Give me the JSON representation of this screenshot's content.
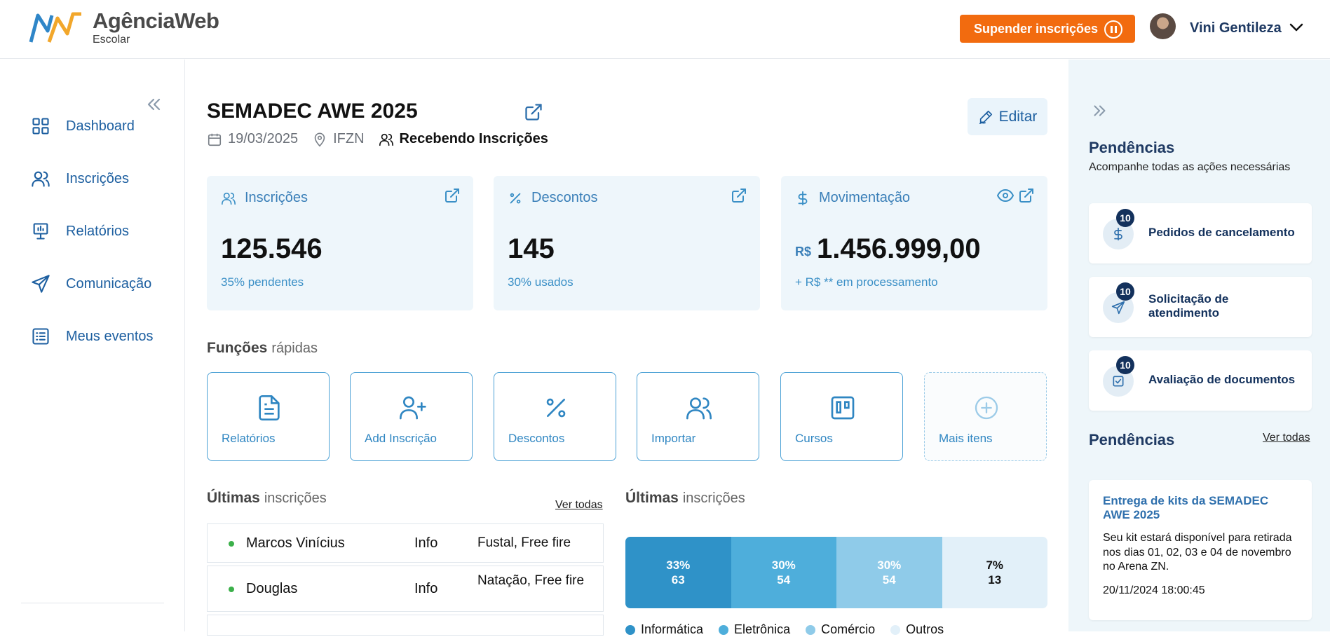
{
  "brand": {
    "name": "AgênciaWeb",
    "sub": "Escolar"
  },
  "header": {
    "suspend_label": "Supender inscrições",
    "user_name": "Vini Gentileza"
  },
  "sidebar": {
    "items": [
      {
        "label": "Dashboard",
        "icon": "grid-icon"
      },
      {
        "label": "Inscrições",
        "icon": "users-icon"
      },
      {
        "label": "Relatórios",
        "icon": "presentation-icon"
      },
      {
        "label": "Comunicação",
        "icon": "send-icon"
      },
      {
        "label": "Meus eventos",
        "icon": "list-icon"
      }
    ]
  },
  "event": {
    "title": "SEMADEC AWE 2025",
    "date": "19/03/2025",
    "location": "IFZN",
    "status": "Recebendo Inscrições",
    "edit_label": "Editar"
  },
  "cards": [
    {
      "title": "Inscrições",
      "value": "125.546",
      "sub": "35% pendentes"
    },
    {
      "title": "Descontos",
      "value": "145",
      "sub": "30% usados"
    },
    {
      "title": "Movimentação",
      "currency": "R$",
      "value": "1.456.999,00",
      "sub": "+ R$ ** em processamento"
    }
  ],
  "quick": {
    "title_bold": "Funções",
    "title_light": "rápidas",
    "items": [
      {
        "label": "Relatórios",
        "icon": "file-text-icon"
      },
      {
        "label": "Add Inscrição",
        "icon": "user-plus-icon"
      },
      {
        "label": "Descontos",
        "icon": "percent-icon"
      },
      {
        "label": "Importar",
        "icon": "users-icon"
      },
      {
        "label": "Cursos",
        "icon": "kanban-icon"
      },
      {
        "label": "Mais itens",
        "icon": "plus-circle-icon"
      }
    ]
  },
  "latest": {
    "title_bold": "Últimas",
    "title_light": "inscrições",
    "see_all": "Ver todas",
    "rows": [
      {
        "name": "Marcos Vinícius",
        "category": "Info",
        "modalities": "Fustal, Free fire"
      },
      {
        "name": "Douglas",
        "category": "Info",
        "modalities": "Natação, Free fire"
      }
    ]
  },
  "distribution": {
    "title_bold": "Últimas",
    "title_light": "inscrições",
    "segments": [
      {
        "percent": "33%",
        "count": "63",
        "share": 0.25,
        "color": "#2f92c8",
        "text_color": "#ffffff"
      },
      {
        "percent": "30%",
        "count": "54",
        "share": 0.25,
        "color": "#4eaedb",
        "text_color": "#ffffff"
      },
      {
        "percent": "30%",
        "count": "54",
        "share": 0.25,
        "color": "#8fcbe9",
        "text_color": "#ffffff"
      },
      {
        "percent": "7%",
        "count": "13",
        "share": 0.25,
        "color": "#e2f0f9",
        "text_color": "#111111"
      }
    ],
    "legend": [
      {
        "label": "Informática",
        "color": "#2f92c8"
      },
      {
        "label": "Eletrônica",
        "color": "#4eaedb"
      },
      {
        "label": "Comércio",
        "color": "#8fcbe9"
      },
      {
        "label": "Outros",
        "color": "#e2f0f9"
      }
    ]
  },
  "pendencias": {
    "title": "Pendências",
    "subtitle": "Acompanhe todas as ações necessárias",
    "items": [
      {
        "count": "10",
        "label": "Pedidos de cancelamento",
        "icon": "dollar-icon"
      },
      {
        "count": "10",
        "label": "Solicitação de atendimento",
        "icon": "send-icon"
      },
      {
        "count": "10",
        "label": "Avaliação de documentos",
        "icon": "check-square-icon"
      }
    ],
    "title2": "Pendências",
    "see_all": "Ver todas",
    "notice": {
      "title": "Entrega de kits da SEMADEC AWE 2025",
      "body": "Seu kit estará disponível para retirada nos dias 01, 02, 03 e 04 de novembro no Arena ZN.",
      "date": "20/11/2024 18:00:45"
    }
  }
}
